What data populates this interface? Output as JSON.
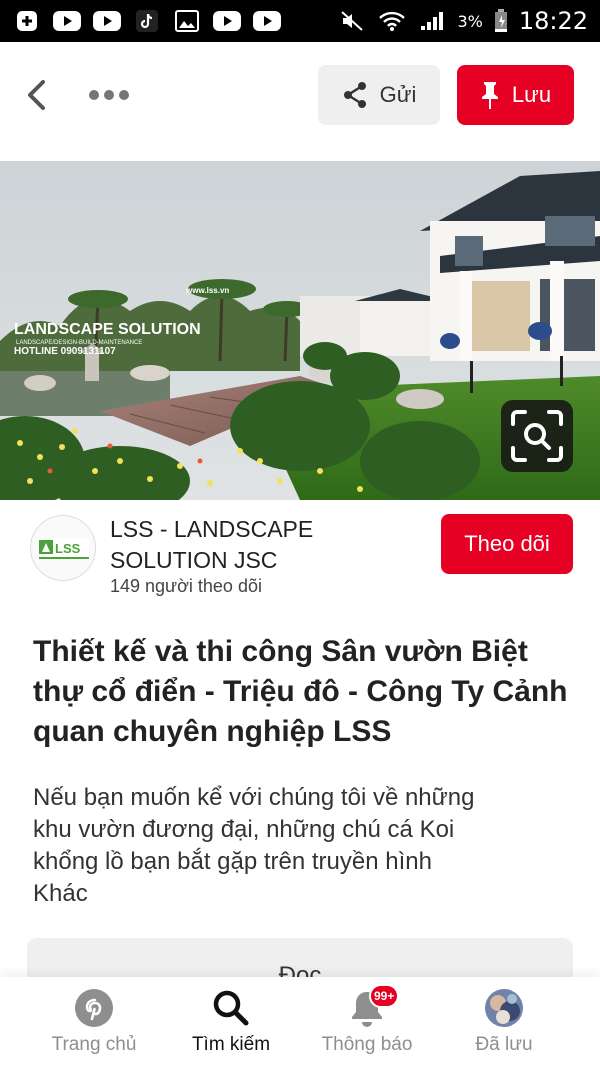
{
  "status_bar": {
    "battery": "3%",
    "time": "18:22"
  },
  "toolbar": {
    "send_label": "Gửi",
    "save_label": "Lưu"
  },
  "hero": {
    "watermark_url": "www.lss.vn",
    "watermark_title": "LANDSCAPE SOLUTION",
    "watermark_sub": "LANDSCAPE/DESIGN-BUILD-MAINTENANCE",
    "watermark_hotline": "HOTLINE 0909131107"
  },
  "profile": {
    "avatar_text": "LSS",
    "name": "LSS - LANDSCAPE SOLUTION JSC",
    "followers": "149 người theo dõi",
    "follow_label": "Theo dõi"
  },
  "pin": {
    "title": "Thiết kế và thi công Sân vườn Biệt thự cổ điển - Triệu đô - Công Ty Cảnh quan chuyên nghiệp LSS",
    "description_lines": [
      "Nếu bạn muốn kể với chúng tôi về những",
      "khu vườn đương đại, những chú cá Koi",
      "khổng lồ bạn bắt gặp trên truyền hình",
      "Khác"
    ],
    "read_label": "Đọc"
  },
  "bottom_nav": {
    "items": [
      {
        "label": "Trang chủ",
        "icon": "pinterest-logo-icon",
        "active": false
      },
      {
        "label": "Tìm kiếm",
        "icon": "search-icon",
        "active": true
      },
      {
        "label": "Thông báo",
        "icon": "bell-icon",
        "active": false,
        "badge": "99+"
      },
      {
        "label": "Đã lưu",
        "icon": "profile-avatar",
        "active": false
      }
    ]
  },
  "colors": {
    "accent": "#e60023",
    "secondary_button": "#efefef",
    "status_bar": "#000000"
  }
}
